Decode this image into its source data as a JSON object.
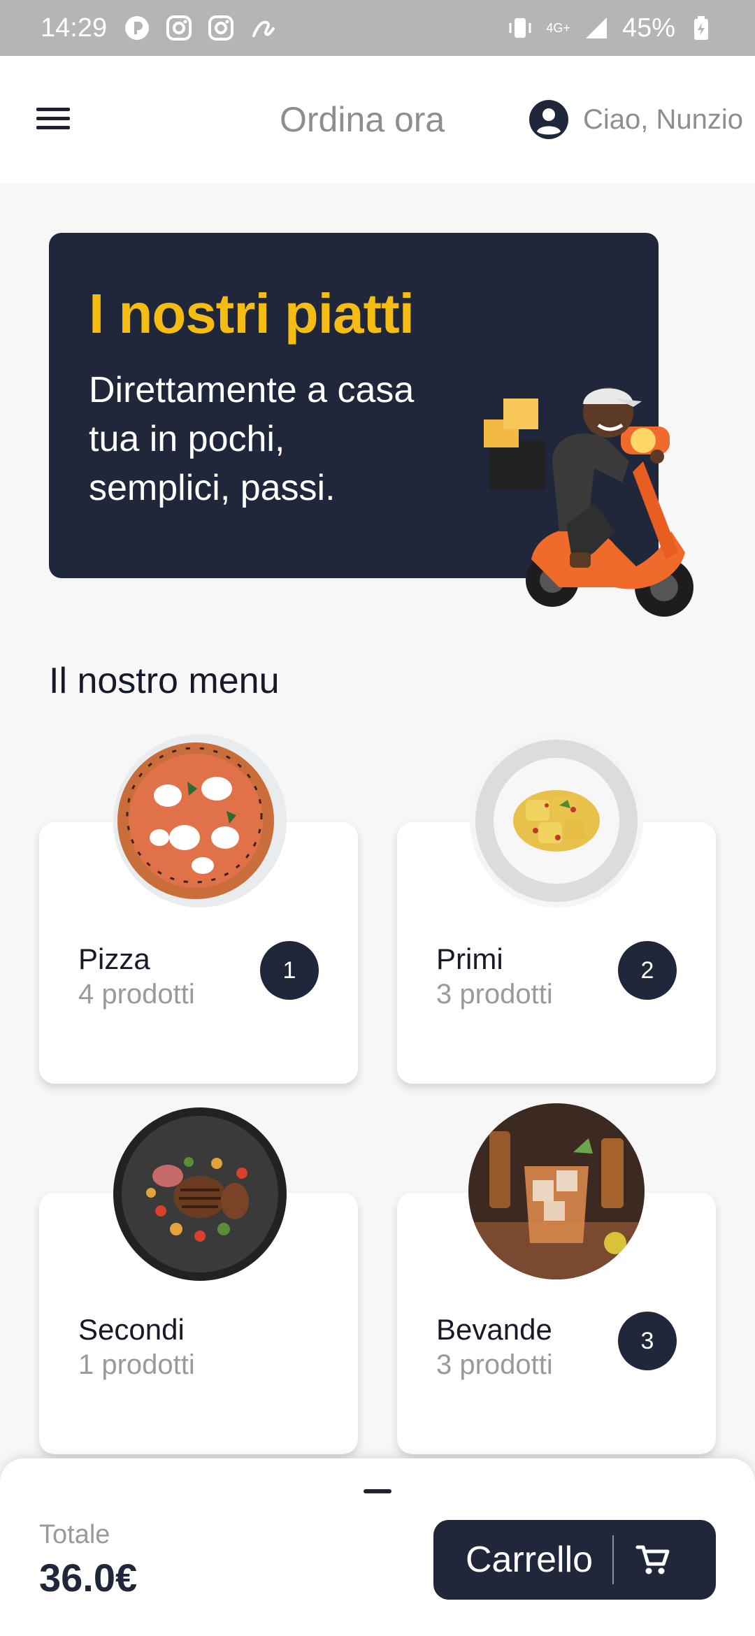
{
  "status_bar": {
    "time": "14:29",
    "network": "4G+",
    "battery": "45%"
  },
  "app_bar": {
    "title": "Ordina ora",
    "greeting": "Ciao, Nunzio"
  },
  "banner": {
    "title": "I nostri piatti",
    "subtitle": "Direttamente a casa tua in pochi, semplici, passi."
  },
  "menu": {
    "section_title": "Il nostro menu",
    "categories": [
      {
        "name": "Pizza",
        "count": "4 prodotti",
        "badge": "1"
      },
      {
        "name": "Primi",
        "count": "3 prodotti",
        "badge": "2"
      },
      {
        "name": "Secondi",
        "count": "1 prodotti",
        "badge": ""
      },
      {
        "name": "Bevande",
        "count": "3 prodotti",
        "badge": "3"
      }
    ]
  },
  "cart": {
    "total_label": "Totale",
    "total_value": "36.0€",
    "button_label": "Carrello"
  },
  "colors": {
    "accent": "#f5bd13",
    "dark": "#20273a",
    "status_bar": "#b5b5b5"
  }
}
